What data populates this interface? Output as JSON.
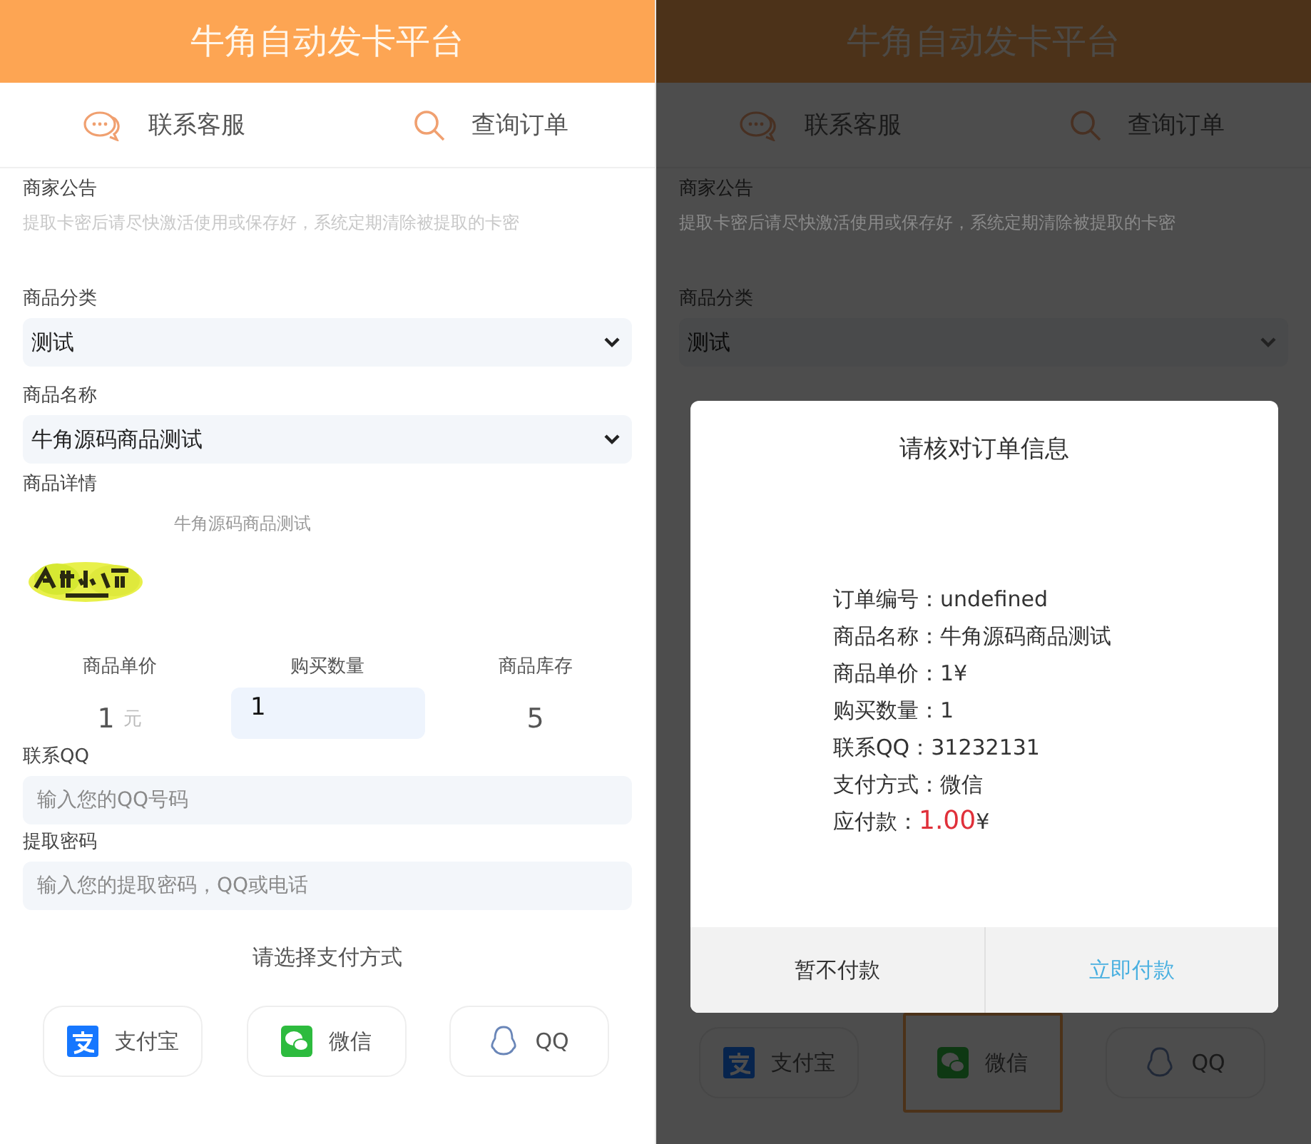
{
  "screens": [
    {
      "dimmed": false,
      "header_title": "牛角自动发卡平台",
      "nav": [
        {
          "label": "联系客服",
          "kind": "chat"
        },
        {
          "label": "查询订单",
          "kind": "search"
        }
      ],
      "notice": {
        "label": "商家公告",
        "text": "提取卡密后请尽快激活使用或保存好，系统定期清除被提取的卡密"
      },
      "sections": [
        {
          "kind": "select",
          "label": "商品分类",
          "value": "测试"
        },
        {
          "kind": "select",
          "label": "商品名称",
          "value": "牛角源码商品测试"
        },
        {
          "kind": "detail",
          "label": "商品详情",
          "text": "牛角源码商品测试"
        },
        {
          "kind": "stats",
          "columns": [
            {
              "kind": "text",
              "label": "商品单价",
              "value": "1",
              "unit": "元"
            },
            {
              "kind": "input",
              "label": "购买数量",
              "value": "1"
            },
            {
              "kind": "text",
              "label": "商品库存",
              "value": "5"
            }
          ]
        },
        {
          "kind": "input",
          "label": "联系QQ",
          "placeholder": "输入您的QQ号码"
        },
        {
          "kind": "input",
          "label": "提取密码",
          "placeholder": "输入您的提取密码，QQ或电话"
        },
        {
          "kind": "heading",
          "text": "请选择支付方式"
        }
      ],
      "payments": [
        {
          "label": "支付宝",
          "kind": "alipay",
          "selected": false
        },
        {
          "label": "微信",
          "kind": "wechat",
          "selected": false
        },
        {
          "label": "QQ",
          "kind": "qq",
          "selected": false
        }
      ]
    },
    {
      "dimmed": true,
      "header_title": "牛角自动发卡平台",
      "nav": [
        {
          "label": "联系客服",
          "kind": "chat"
        },
        {
          "label": "查询订单",
          "kind": "search"
        }
      ],
      "notice": {
        "label": "商家公告",
        "text": "提取卡密后请尽快激活使用或保存好，系统定期清除被提取的卡密"
      },
      "sections": [
        {
          "kind": "select",
          "label": "商品分类",
          "value": "测试"
        }
      ],
      "payments": [
        {
          "label": "支付宝",
          "kind": "alipay",
          "selected": false
        },
        {
          "label": "微信",
          "kind": "wechat",
          "selected": true
        },
        {
          "label": "QQ",
          "kind": "qq",
          "selected": false
        }
      ],
      "dialog": {
        "title": "请核对订单信息",
        "rows": [
          {
            "label": "订单编号：",
            "value": "undefined",
            "highlight": false
          },
          {
            "label": "商品名称：",
            "value": "牛角源码商品测试",
            "highlight": false
          },
          {
            "label": "商品单价：",
            "value": "1¥",
            "highlight": false
          },
          {
            "label": "购买数量：",
            "value": "1",
            "highlight": false
          },
          {
            "label": "联系QQ：",
            "value": "31232131",
            "highlight": false
          },
          {
            "label": "支付方式：",
            "value": "微信",
            "highlight": false
          },
          {
            "label": "应付款：",
            "value": "1.00",
            "unit": "¥",
            "highlight": true
          }
        ],
        "buttons": [
          {
            "label": "暂不付款",
            "kind": "cancel"
          },
          {
            "label": "立即付款",
            "kind": "confirm"
          }
        ]
      }
    }
  ]
}
